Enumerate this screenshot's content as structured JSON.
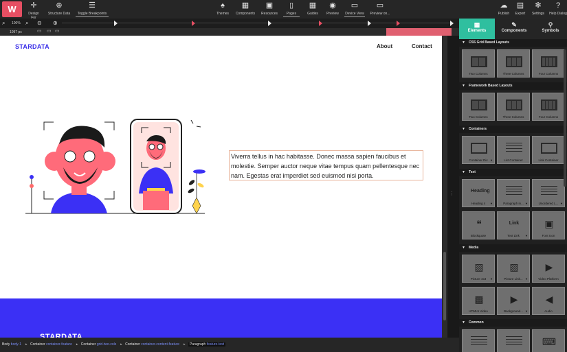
{
  "toolbar": {
    "logo": "W",
    "design_for": "Design For",
    "structure_data": "Structure Data",
    "toggle_breakpoints": "Toggle Breakpoints",
    "themes": "Themes",
    "components": "Components",
    "resources": "Resources",
    "pages": "Pages",
    "guides": "Guides",
    "preview": "Preview",
    "device_view": "Device View",
    "preview_on": "Preview on...",
    "publish": "Publish",
    "export": "Export",
    "settings": "Settings",
    "help": "Help Dialog"
  },
  "subbar": {
    "zoom": "100%",
    "width": "1097 px"
  },
  "canvas": {
    "brand": "STARDATA",
    "nav": [
      "About",
      "Contact"
    ],
    "paragraph": "Viverra tellus in hac habitasse. Donec massa sapien faucibus et molestie. Semper auctor neque vitae tempus quam pellentesque nec nam. Egestas erat imperdiet sed euismod nisi porta.",
    "footer_brand": "STARDATA"
  },
  "breadcrumb": [
    {
      "type": "Body",
      "cls": "body-1"
    },
    {
      "type": "Container",
      "cls": "container-feature"
    },
    {
      "type": "Container",
      "cls": "grid-two-cols"
    },
    {
      "type": "Container",
      "cls": "container-content-feature"
    },
    {
      "type": "Paragraph",
      "cls": "feature-text"
    }
  ],
  "panel": {
    "tabs": [
      "Elements",
      "Components",
      "Symbols"
    ],
    "sections": [
      {
        "title": "CSS Grid Based Layouts",
        "items": [
          "Two Columns",
          "Three Columns",
          "Four Columns"
        ]
      },
      {
        "title": "Framework Based Layouts",
        "items": [
          "Two Columns",
          "Three Columns",
          "Four Columns"
        ]
      },
      {
        "title": "Containers",
        "items": [
          "Container Div",
          "List Container",
          "Link Container"
        ]
      },
      {
        "title": "Text",
        "items": [
          "Heading 4",
          "Paragraph in...",
          "Unordered L...",
          "Blockquote",
          "Text Link",
          "Font Icon"
        ]
      },
      {
        "title": "Media",
        "items": [
          "Picture 4x3",
          "Picture Link...",
          "Video Platform",
          "HTML5 Video",
          "Background...",
          "Audio"
        ]
      },
      {
        "title": "Common",
        "items": [
          "",
          "",
          ""
        ]
      }
    ],
    "tile_text": {
      "heading": "Heading",
      "link": "Link"
    }
  }
}
